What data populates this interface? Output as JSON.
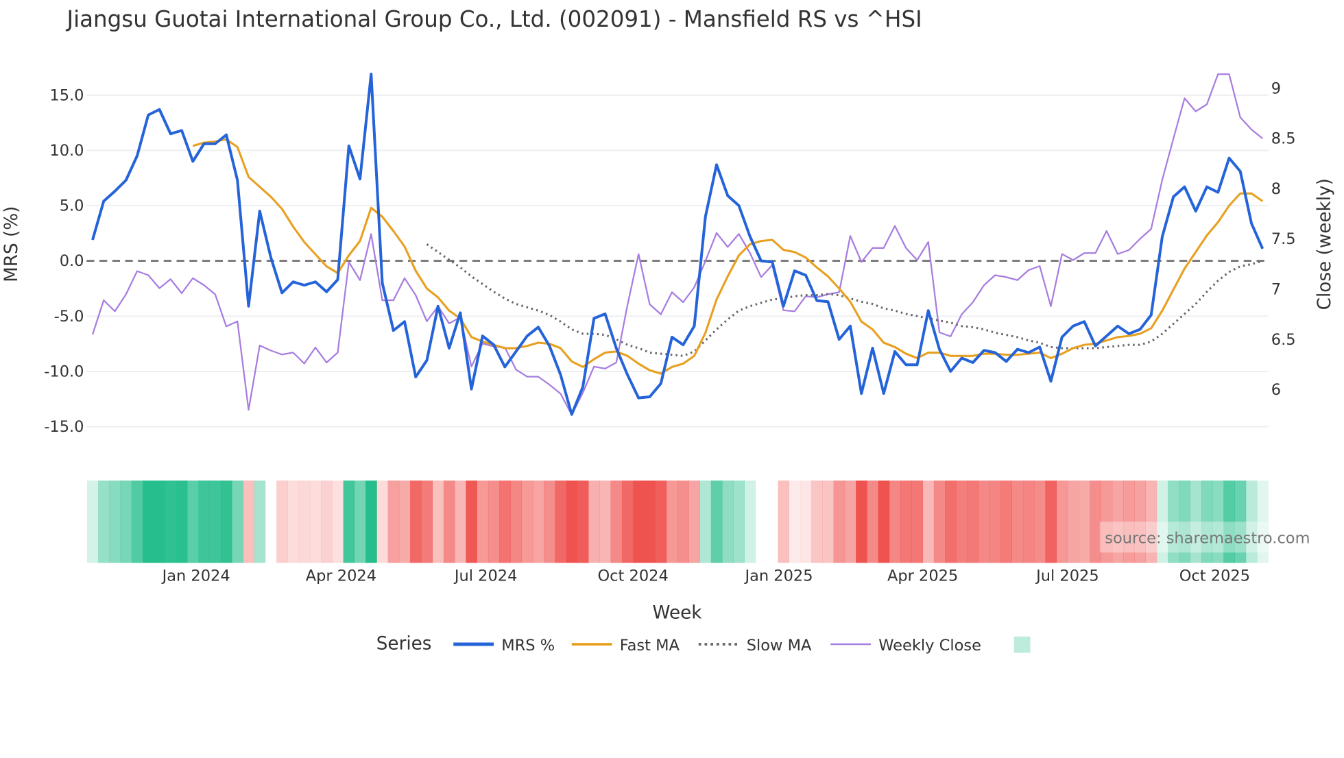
{
  "chart_data": {
    "type": "line",
    "title": "Jiangsu Guotai International Group Co., Ltd. (002091) - Mansfield RS vs ^HSI",
    "xlabel": "Week",
    "ylabel": "MRS (%)",
    "y2label": "Close (weekly)",
    "ylim": [
      -16.5,
      18
    ],
    "y2lim": [
      5.55,
      9.2
    ],
    "yticks": [
      "15.0",
      "10.0",
      "5.0",
      "0.0",
      "-5.0",
      "-10.0",
      "-15.0"
    ],
    "ytick_values": [
      15,
      10,
      5,
      0,
      -5,
      -10,
      -15
    ],
    "y2ticks": [
      "9",
      "8.5",
      "8",
      "7.5",
      "7",
      "6.5",
      "6"
    ],
    "y2tick_values": [
      9,
      8.5,
      8,
      7.5,
      7,
      6.5,
      6
    ],
    "xticks": [
      "Jan 2024",
      "Apr 2024",
      "Jul 2024",
      "Oct 2024",
      "Jan 2025",
      "Apr 2025",
      "Jul 2025",
      "Oct 2025"
    ],
    "xtick_week_index": [
      9.3,
      22.3,
      35.3,
      48.5,
      61.6,
      74.5,
      87.5,
      100.7
    ],
    "grid": true,
    "zero_line": "dashed",
    "legend": {
      "title": "Series",
      "placement": "bottom-center",
      "entries": [
        "MRS %",
        "Fast MA",
        "Slow MA",
        "Weekly Close"
      ]
    },
    "source": "source: sharemaestro.com",
    "colors": {
      "mrs": "#2563d9",
      "fast": "#e8a020",
      "slow": "#666666",
      "close": "#a77de0",
      "pos": "#26be8c",
      "neg": "#ef5350"
    },
    "series": [
      {
        "name": "MRS %",
        "axis": "left",
        "values": [
          1.9,
          5.4,
          6.3,
          7.3,
          9.5,
          13.2,
          13.7,
          11.5,
          11.8,
          9.0,
          10.6,
          10.6,
          11.4,
          7.3,
          -4.1,
          4.5,
          0.3,
          -2.9,
          -1.9,
          -2.2,
          -1.9,
          -2.8,
          -1.7,
          10.4,
          7.4,
          16.9,
          -2.0,
          -6.3,
          -5.5,
          -10.5,
          -9.0,
          -4.1,
          -7.9,
          -4.7,
          -11.6,
          -6.8,
          -7.6,
          -9.6,
          -8.2,
          -6.8,
          -6.0,
          -7.7,
          -10.3,
          -13.9,
          -11.4,
          -5.2,
          -4.8,
          -7.9,
          -10.3,
          -12.4,
          -12.3,
          -11.1,
          -6.9,
          -7.6,
          -5.9,
          4.0,
          8.7,
          5.9,
          5.0,
          2.2,
          0.0,
          -0.1,
          -4.1,
          -0.9,
          -1.3,
          -3.6,
          -3.7,
          -7.1,
          -5.9,
          -12.0,
          -7.9,
          -12.0,
          -8.2,
          -9.4,
          -9.4,
          -4.5,
          -8.0,
          -10.0,
          -8.8,
          -9.2,
          -8.1,
          -8.3,
          -9.1,
          -8.0,
          -8.3,
          -7.8,
          -10.9,
          -6.9,
          -5.9,
          -5.5,
          -7.7,
          -6.8,
          -5.9,
          -6.6,
          -6.2,
          -4.9,
          2.2,
          5.8,
          6.7,
          4.5,
          6.7,
          6.2,
          9.3,
          8.1,
          3.4,
          1.1
        ]
      },
      {
        "name": "Fast MA",
        "axis": "left",
        "values": [
          null,
          null,
          null,
          null,
          null,
          null,
          null,
          null,
          null,
          10.4,
          10.7,
          10.8,
          11.0,
          10.3,
          7.6,
          6.7,
          5.8,
          4.7,
          3.1,
          1.7,
          0.6,
          -0.5,
          -1.1,
          0.5,
          1.8,
          4.8,
          4.0,
          2.7,
          1.3,
          -0.9,
          -2.5,
          -3.3,
          -4.5,
          -5.2,
          -6.9,
          -7.3,
          -7.6,
          -7.9,
          -7.9,
          -7.7,
          -7.4,
          -7.5,
          -7.9,
          -9.1,
          -9.6,
          -8.9,
          -8.3,
          -8.2,
          -8.6,
          -9.3,
          -9.9,
          -10.2,
          -9.6,
          -9.3,
          -8.6,
          -6.5,
          -3.5,
          -1.4,
          0.5,
          1.5,
          1.8,
          1.9,
          1.0,
          0.8,
          0.3,
          -0.6,
          -1.4,
          -2.5,
          -3.7,
          -5.5,
          -6.2,
          -7.4,
          -7.8,
          -8.4,
          -8.8,
          -8.3,
          -8.3,
          -8.6,
          -8.6,
          -8.6,
          -8.4,
          -8.4,
          -8.5,
          -8.5,
          -8.4,
          -8.3,
          -8.8,
          -8.4,
          -7.9,
          -7.6,
          -7.5,
          -7.2,
          -6.9,
          -6.8,
          -6.6,
          -6.1,
          -4.5,
          -2.6,
          -0.7,
          0.8,
          2.3,
          3.5,
          5.0,
          6.1,
          6.1,
          5.4
        ]
      },
      {
        "name": "Slow MA",
        "axis": "left",
        "values": [
          null,
          null,
          null,
          null,
          null,
          null,
          null,
          null,
          null,
          null,
          null,
          null,
          null,
          null,
          null,
          null,
          null,
          null,
          null,
          null,
          null,
          null,
          null,
          null,
          null,
          null,
          null,
          null,
          null,
          null,
          1.5,
          0.8,
          0.1,
          -0.6,
          -1.4,
          -2.1,
          -2.8,
          -3.4,
          -3.9,
          -4.2,
          -4.5,
          -4.9,
          -5.5,
          -6.2,
          -6.6,
          -6.6,
          -6.7,
          -7.1,
          -7.6,
          -7.9,
          -8.3,
          -8.4,
          -8.5,
          -8.6,
          -8.2,
          -7.2,
          -6.2,
          -5.3,
          -4.5,
          -4.1,
          -3.8,
          -3.5,
          -3.4,
          -3.2,
          -3.1,
          -3.1,
          -3.0,
          -3.1,
          -3.4,
          -3.7,
          -3.9,
          -4.3,
          -4.5,
          -4.8,
          -5.0,
          -5.2,
          -5.4,
          -5.6,
          -5.9,
          -6.0,
          -6.2,
          -6.5,
          -6.7,
          -6.9,
          -7.2,
          -7.4,
          -7.8,
          -7.9,
          -7.9,
          -7.9,
          -7.9,
          -7.8,
          -7.7,
          -7.6,
          -7.6,
          -7.3,
          -6.6,
          -5.7,
          -4.8,
          -3.9,
          -2.8,
          -1.8,
          -1.0,
          -0.5,
          -0.3,
          0.0
        ]
      },
      {
        "name": "Weekly Close",
        "axis": "right",
        "values": [
          6.55,
          6.89,
          6.78,
          6.95,
          7.18,
          7.14,
          7.01,
          7.1,
          6.96,
          7.11,
          7.04,
          6.95,
          6.63,
          6.68,
          5.8,
          6.44,
          6.39,
          6.35,
          6.37,
          6.26,
          6.42,
          6.27,
          6.37,
          7.27,
          7.09,
          7.55,
          6.89,
          6.89,
          7.11,
          6.94,
          6.68,
          6.83,
          6.66,
          6.72,
          6.23,
          6.46,
          6.43,
          6.42,
          6.2,
          6.13,
          6.13,
          6.05,
          5.96,
          5.75,
          5.97,
          6.23,
          6.21,
          6.27,
          6.84,
          7.35,
          6.85,
          6.75,
          6.97,
          6.87,
          7.02,
          7.28,
          7.56,
          7.42,
          7.55,
          7.36,
          7.12,
          7.24,
          6.79,
          6.78,
          6.93,
          6.92,
          6.95,
          6.97,
          7.53,
          7.27,
          7.41,
          7.41,
          7.63,
          7.41,
          7.29,
          7.47,
          6.57,
          6.53,
          6.75,
          6.87,
          7.04,
          7.14,
          7.12,
          7.09,
          7.19,
          7.23,
          6.83,
          7.35,
          7.29,
          7.36,
          7.36,
          7.58,
          7.35,
          7.39,
          7.5,
          7.6,
          8.09,
          8.5,
          8.9,
          8.77,
          8.84,
          9.14,
          9.14,
          8.71,
          8.59,
          8.5
        ]
      }
    ]
  }
}
